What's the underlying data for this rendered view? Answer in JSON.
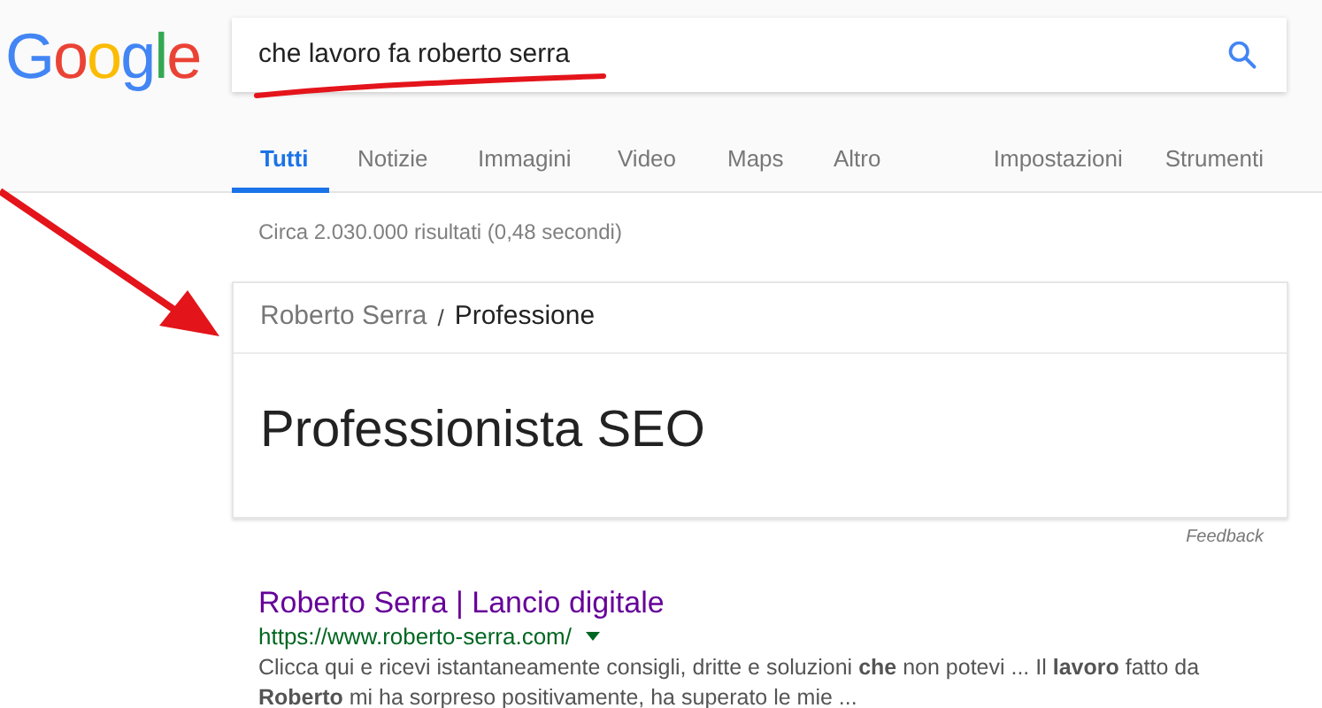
{
  "logo": [
    {
      "text": "G",
      "color": "#4285f4"
    },
    {
      "text": "o",
      "color": "#ea4335"
    },
    {
      "text": "o",
      "color": "#fbbc05"
    },
    {
      "text": "g",
      "color": "#4285f4"
    },
    {
      "text": "l",
      "color": "#34a853"
    },
    {
      "text": "e",
      "color": "#ea4335"
    }
  ],
  "search": {
    "value": "che lavoro fa roberto serra"
  },
  "tabs": [
    {
      "label": "Tutti",
      "selected": true
    },
    {
      "label": "Notizie",
      "selected": false
    },
    {
      "label": "Immagini",
      "selected": false
    },
    {
      "label": "Video",
      "selected": false
    },
    {
      "label": "Maps",
      "selected": false
    },
    {
      "label": "Altro",
      "selected": false
    }
  ],
  "tools": [
    "Impostazioni",
    "Strumenti"
  ],
  "result_stats": "Circa 2.030.000 risultati (0,48 secondi)",
  "answer_card": {
    "entity": "Roberto Serra",
    "separator": "/",
    "attribute": "Professione",
    "answer": "Professionista SEO"
  },
  "feedback": "Feedback",
  "results": [
    {
      "title": "Roberto Serra | Lancio digitale",
      "url": "https://www.roberto-serra.com/",
      "snippet": "Clicca qui e ricevi istantaneamente consigli, dritte e soluzioni **che** non potevi ... Il **lavoro** fatto da **Roberto** mi ha sorpreso positivamente, ha superato le mie ..."
    }
  ]
}
